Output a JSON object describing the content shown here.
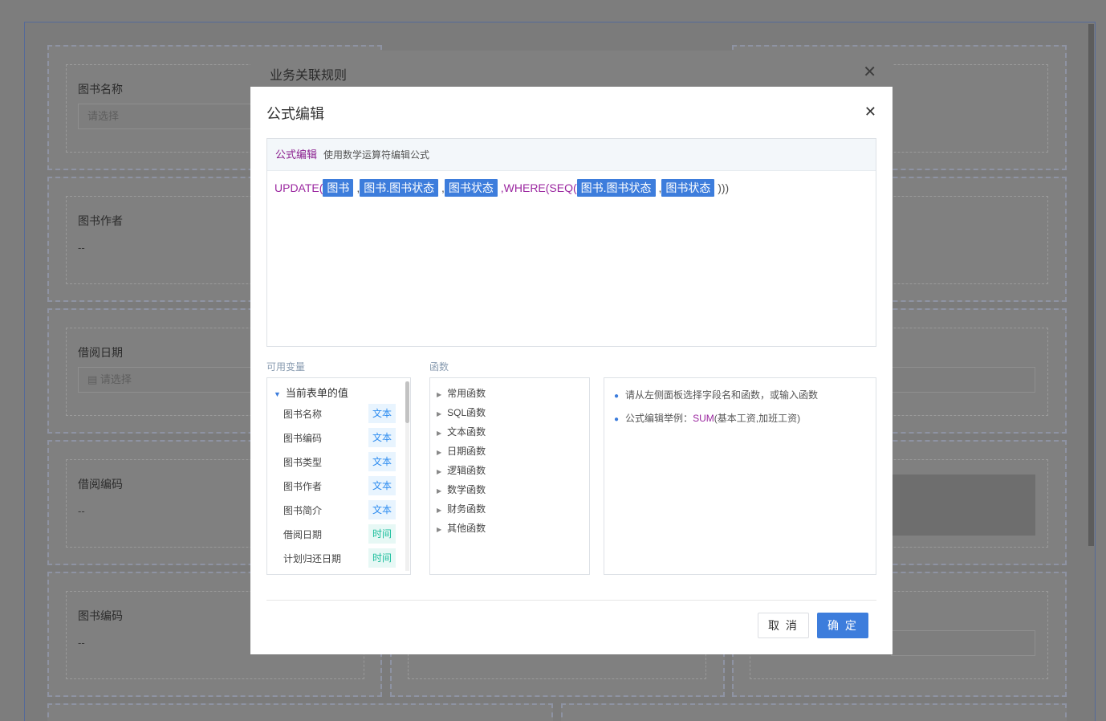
{
  "background": {
    "fields": [
      {
        "label": "图书名称",
        "value": "请选择"
      },
      {
        "label": "图书作者",
        "value": "--"
      },
      {
        "label": "借阅日期",
        "value": "请选择"
      },
      {
        "label": "借阅编码",
        "value": "--"
      },
      {
        "label": "图书编码",
        "value": "--"
      }
    ],
    "calendar_icon": "calendar-icon"
  },
  "outer_dialog": {
    "title": "业务关联规则",
    "close_icon": "close-icon"
  },
  "modal": {
    "title": "公式编辑",
    "close_icon": "close-icon",
    "editor": {
      "tag": "公式编辑",
      "hint": "使用数学运算符编辑公式",
      "formula": {
        "fn_update": "UPDATE(",
        "token_1": "图书",
        "sep_1": ",",
        "token_2": "图书.图书状态",
        "sep_2": ",",
        "token_3": "图书状态",
        "fn_where": ",WHERE(SEQ(",
        "token_4": "图书.图书状态",
        "sep_3": ",",
        "token_5": "图书状态",
        "close": ")))"
      }
    },
    "variables_label": "可用变量",
    "functions_label": "函数",
    "variables": {
      "group": "当前表单的值",
      "items": [
        {
          "name": "图书名称",
          "type": "文本"
        },
        {
          "name": "图书编码",
          "type": "文本"
        },
        {
          "name": "图书类型",
          "type": "文本"
        },
        {
          "name": "图书作者",
          "type": "文本"
        },
        {
          "name": "图书简介",
          "type": "文本"
        },
        {
          "name": "借阅日期",
          "type": "时间"
        },
        {
          "name": "计划归还日期",
          "type": "时间"
        }
      ]
    },
    "functions": [
      "常用函数",
      "SQL函数",
      "文本函数",
      "日期函数",
      "逻辑函数",
      "数学函数",
      "财务函数",
      "其他函数"
    ],
    "help": {
      "line1": "请从左侧面板选择字段名和函数，或输入函数",
      "line2_prefix": "公式编辑举例：",
      "line2_fn": "SUM",
      "line2_args": "(基本工资,加班工资)"
    },
    "buttons": {
      "cancel": "取 消",
      "ok": "确 定"
    }
  },
  "colors": {
    "accent": "#3d7ddc",
    "formula_text": "#9b27a0",
    "badge_text": "#2d8cf0",
    "badge_time": "#19be9b"
  }
}
